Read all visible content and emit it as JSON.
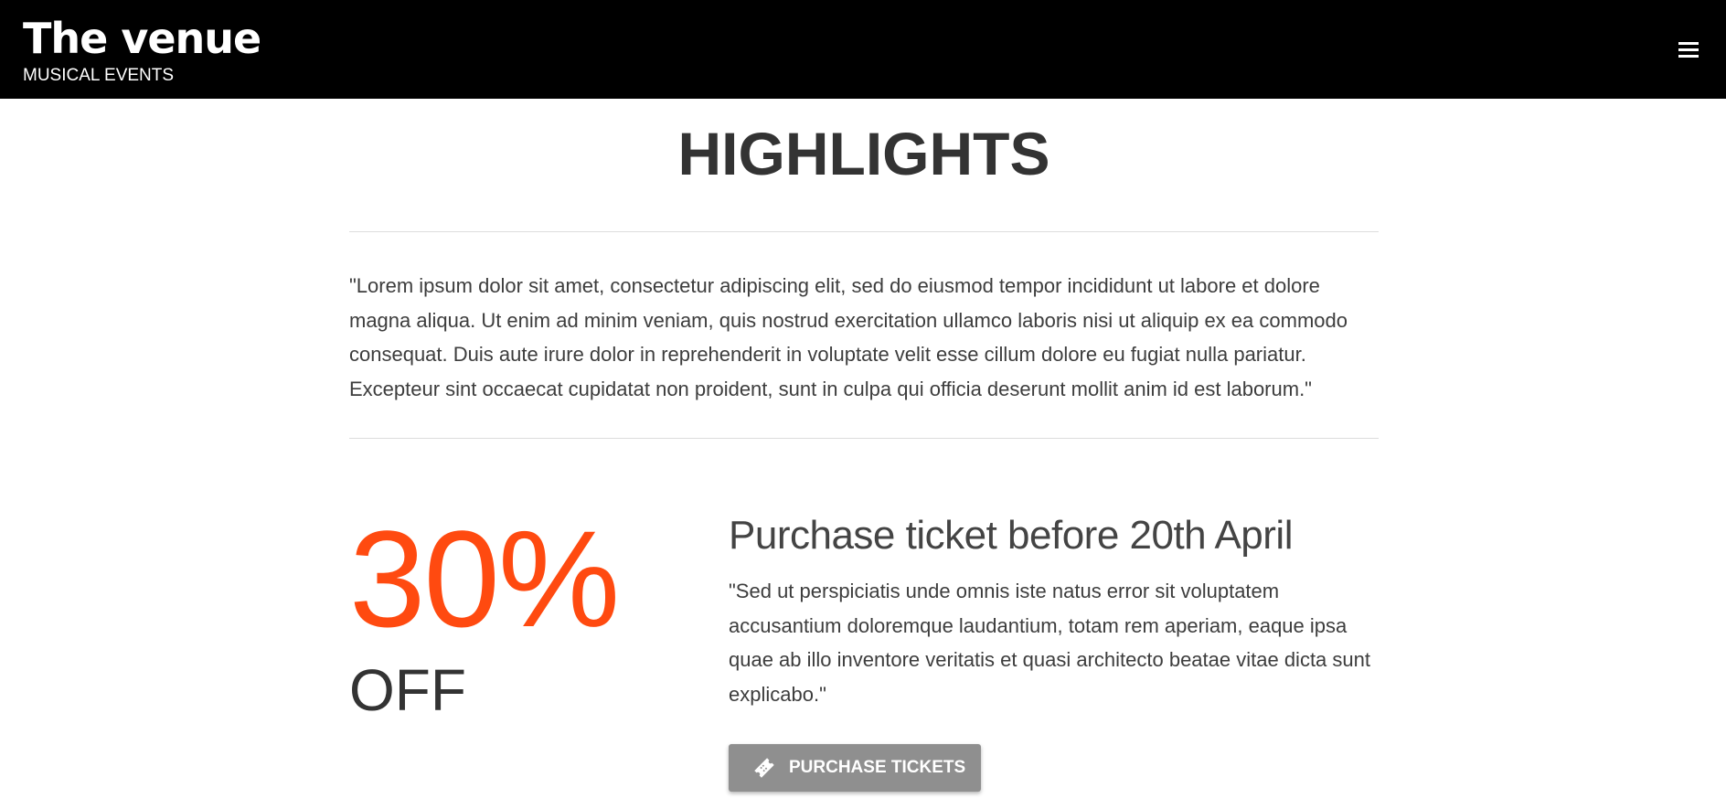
{
  "header": {
    "brand_title": "The venue",
    "brand_subtitle": "MUSICAL EVENTS",
    "menu_icon": "hamburger-menu-icon",
    "background_color": "#000000"
  },
  "main": {
    "heading": "HIGHLIGHTS",
    "intro_text": "\"Lorem ipsum dolor sit amet, consectetur adipiscing elit, sed do eiusmod tempor incididunt ut labore et dolore magna aliqua. Ut enim ad minim veniam, quis nostrud exercitation ullamco laboris nisi ut aliquip ex ea commodo consequat. Duis aute irure dolor in reprehenderit in voluptate velit esse cillum dolore eu fugiat nulla pariatur. Excepteur sint occaecat cupidatat non proident, sunt in culpa qui officia deserunt mollit anim id est laborum.\""
  },
  "offer": {
    "discount": "30%",
    "discount_suffix": "OFF",
    "accent_color": "#ff4a10",
    "title": "Purchase ticket before 20th April",
    "description": "\"Sed ut perspiciatis unde omnis iste natus error sit voluptatem accusantium doloremque laudantium, totam rem aperiam, eaque ipsa quae ab illo inventore veritatis et quasi architecto beatae vitae dicta sunt explicabo.\"",
    "button_label": "PURCHASE TICKETS",
    "button_icon": "ticket-icon",
    "button_color": "#8f8f8f"
  }
}
